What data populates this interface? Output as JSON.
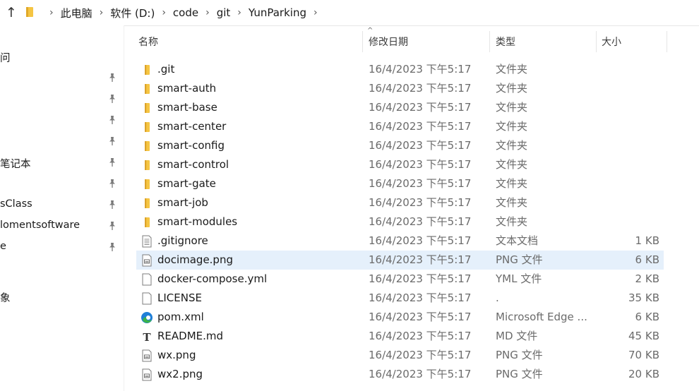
{
  "address": {
    "breadcrumbs": [
      "此电脑",
      "软件 (D:)",
      "code",
      "git",
      "YunParking"
    ]
  },
  "sidebar": {
    "items": [
      {
        "label": "问",
        "pinned": false
      },
      {
        "label": "",
        "pinned": true
      },
      {
        "label": "",
        "pinned": true
      },
      {
        "label": "",
        "pinned": true
      },
      {
        "label": "",
        "pinned": true
      },
      {
        "label": "笔记本",
        "pinned": true
      },
      {
        "label": "",
        "pinned": true
      },
      {
        "label": "sClass",
        "pinned": true
      },
      {
        "label": "lomentsoftware",
        "pinned": true
      },
      {
        "label": "e",
        "pinned": true
      },
      {
        "label": "象",
        "pinned": false
      }
    ]
  },
  "columns": {
    "name": "名称",
    "date": "修改日期",
    "type": "类型",
    "size": "大小"
  },
  "files": [
    {
      "name": ".git",
      "date": "16/4/2023 下午5:17",
      "type": "文件夹",
      "size": "",
      "icon": "folder-icon"
    },
    {
      "name": "smart-auth",
      "date": "16/4/2023 下午5:17",
      "type": "文件夹",
      "size": "",
      "icon": "folder-icon"
    },
    {
      "name": "smart-base",
      "date": "16/4/2023 下午5:17",
      "type": "文件夹",
      "size": "",
      "icon": "folder-icon"
    },
    {
      "name": "smart-center",
      "date": "16/4/2023 下午5:17",
      "type": "文件夹",
      "size": "",
      "icon": "folder-icon"
    },
    {
      "name": "smart-config",
      "date": "16/4/2023 下午5:17",
      "type": "文件夹",
      "size": "",
      "icon": "folder-icon"
    },
    {
      "name": "smart-control",
      "date": "16/4/2023 下午5:17",
      "type": "文件夹",
      "size": "",
      "icon": "folder-icon"
    },
    {
      "name": "smart-gate",
      "date": "16/4/2023 下午5:17",
      "type": "文件夹",
      "size": "",
      "icon": "folder-icon"
    },
    {
      "name": "smart-job",
      "date": "16/4/2023 下午5:17",
      "type": "文件夹",
      "size": "",
      "icon": "folder-icon"
    },
    {
      "name": "smart-modules",
      "date": "16/4/2023 下午5:17",
      "type": "文件夹",
      "size": "",
      "icon": "folder-icon"
    },
    {
      "name": ".gitignore",
      "date": "16/4/2023 下午5:17",
      "type": "文本文档",
      "size": "1 KB",
      "icon": "text-file-icon"
    },
    {
      "name": "docimage.png",
      "date": "16/4/2023 下午5:17",
      "type": "PNG 文件",
      "size": "6 KB",
      "icon": "image-file-icon",
      "selected": true
    },
    {
      "name": "docker-compose.yml",
      "date": "16/4/2023 下午5:17",
      "type": "YML 文件",
      "size": "2 KB",
      "icon": "blank-file-icon"
    },
    {
      "name": "LICENSE",
      "date": "16/4/2023 下午5:17",
      "type": ".",
      "size": "35 KB",
      "icon": "blank-file-icon"
    },
    {
      "name": "pom.xml",
      "date": "16/4/2023 下午5:17",
      "type": "Microsoft Edge ...",
      "size": "6 KB",
      "icon": "edge-icon"
    },
    {
      "name": "README.md",
      "date": "16/4/2023 下午5:17",
      "type": "MD 文件",
      "size": "45 KB",
      "icon": "typora-icon"
    },
    {
      "name": "wx.png",
      "date": "16/4/2023 下午5:17",
      "type": "PNG 文件",
      "size": "70 KB",
      "icon": "image-file-icon"
    },
    {
      "name": "wx2.png",
      "date": "16/4/2023 下午5:17",
      "type": "PNG 文件",
      "size": "20 KB",
      "icon": "image-file-icon"
    }
  ],
  "colors": {
    "selected_row": "#e5f0fb",
    "folder": "#f5c543",
    "edge_blue": "#1f7fd8",
    "edge_green": "#3bb34a"
  }
}
